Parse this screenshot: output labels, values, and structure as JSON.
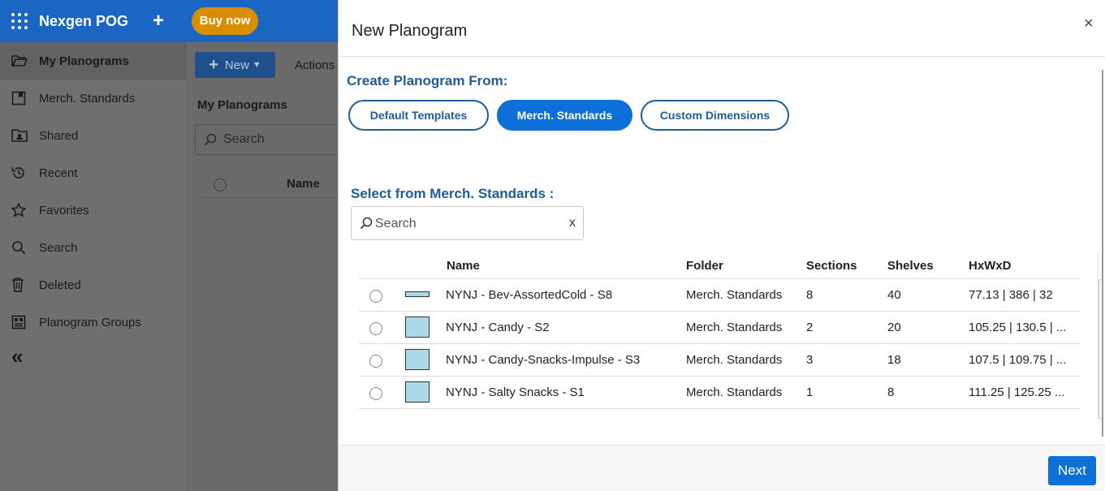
{
  "app": {
    "brand": "Nexgen POG",
    "buy_now": "Buy now"
  },
  "sidebar": {
    "items": [
      {
        "label": "My Planograms",
        "icon": "folder-open-icon",
        "active": true
      },
      {
        "label": "Merch. Standards",
        "icon": "merch-standards-icon"
      },
      {
        "label": "Shared",
        "icon": "shared-folder-icon"
      },
      {
        "label": "Recent",
        "icon": "history-icon"
      },
      {
        "label": "Favorites",
        "icon": "star-icon"
      },
      {
        "label": "Search",
        "icon": "search-icon"
      },
      {
        "label": "Deleted",
        "icon": "trash-icon"
      },
      {
        "label": "Planogram Groups",
        "icon": "planogram-groups-icon"
      }
    ]
  },
  "main": {
    "new_label": "New",
    "actions_label": "Actions",
    "title": "My Planograms",
    "search_placeholder": "Search",
    "col_name": "Name"
  },
  "modal": {
    "title": "New Planogram",
    "create_from_label": "Create Planogram From:",
    "options": [
      "Default Templates",
      "Merch. Standards",
      "Custom Dimensions"
    ],
    "selected_option": "Merch. Standards",
    "select_label": "Select from Merch. Standards :",
    "search_placeholder": "Search",
    "clear_label": "x",
    "columns": [
      "Name",
      "Folder",
      "Sections",
      "Shelves",
      "HxWxD"
    ],
    "rows": [
      {
        "name": "NYNJ - Bev-AssortedCold - S8",
        "folder": "Merch. Standards",
        "sections": "8",
        "shelves": "40",
        "dims": "77.13 | 386 | 32"
      },
      {
        "name": "NYNJ - Candy - S2",
        "folder": "Merch. Standards",
        "sections": "2",
        "shelves": "20",
        "dims": "105.25 | 130.5 | ..."
      },
      {
        "name": "NYNJ - Candy-Snacks-Impulse - S3",
        "folder": "Merch. Standards",
        "sections": "3",
        "shelves": "18",
        "dims": "107.5 | 109.75 | ..."
      },
      {
        "name": "NYNJ - Salty Snacks - S1",
        "folder": "Merch. Standards",
        "sections": "1",
        "shelves": "8",
        "dims": "111.25 | 125.25 ..."
      }
    ],
    "next_label": "Next",
    "colors": {
      "accent": "#0d6fd8",
      "heading": "#1f5c99",
      "thumbnail": "#add8e6"
    }
  }
}
